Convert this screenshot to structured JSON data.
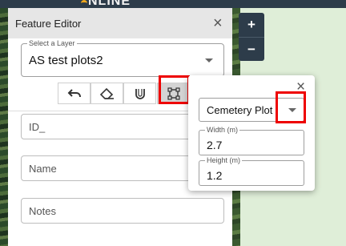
{
  "app": {
    "logo_text": "NLINE"
  },
  "panel": {
    "title": "Feature Editor",
    "close_label": "×",
    "layer_select": {
      "label": "Select a Layer",
      "value": "AS test plots2"
    },
    "toolbar": {
      "tools": [
        {
          "name": "undo",
          "icon": "undo-icon"
        },
        {
          "name": "eraser",
          "icon": "eraser-icon"
        },
        {
          "name": "snap",
          "icon": "magnet-icon"
        },
        {
          "name": "draw-shape",
          "icon": "bounding-box-icon",
          "active": true
        }
      ]
    },
    "fields": [
      {
        "placeholder": "ID_"
      },
      {
        "placeholder": "Name"
      },
      {
        "placeholder": "Notes"
      }
    ]
  },
  "map_controls": {
    "zoom_in": "+",
    "zoom_out": "−"
  },
  "popup": {
    "close_label": "×",
    "plot_type": {
      "value": "Cemetery Plot"
    },
    "width": {
      "label": "Width (m)",
      "value": "2.7"
    },
    "height": {
      "label": "Height (m)",
      "value": "1.2"
    }
  },
  "colors": {
    "highlight": "#e00000",
    "header_bg": "#2d3c4a",
    "map_bg": "#dfeed8"
  }
}
